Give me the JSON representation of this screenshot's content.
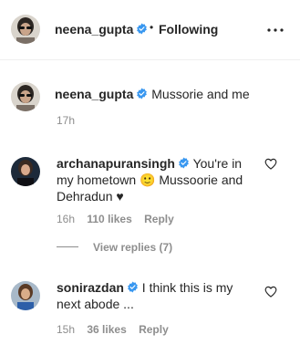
{
  "post_header": {
    "username": "neena_gupta",
    "separator": "•",
    "follow_status": "Following"
  },
  "caption": {
    "username": "neena_gupta",
    "text": "Mussorie and me",
    "time": "17h"
  },
  "comments": [
    {
      "username": "archanapuransingh",
      "text": "You're in my hometown 🙂 Mussoorie and Dehradun ♥",
      "time": "16h",
      "likes": "110 likes",
      "reply": "Reply"
    },
    {
      "username": "sonirazdan",
      "text": "I think this is my next abode ...",
      "time": "15h",
      "likes": "36 likes",
      "reply": "Reply"
    }
  ],
  "view_replies": "View replies (7)",
  "colors": {
    "verified_blue": "#3897f0",
    "text": "#262626",
    "muted": "#8e8e8e"
  },
  "icons": {
    "verified": "verified-badge-icon",
    "more": "more-options-icon",
    "like": "heart-outline-icon"
  }
}
